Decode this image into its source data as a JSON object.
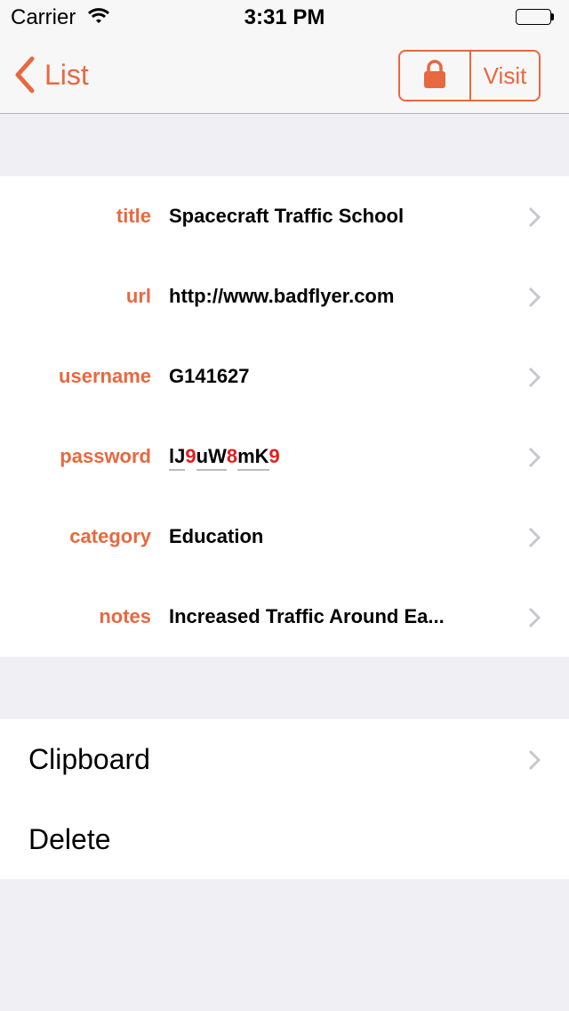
{
  "status_bar": {
    "carrier": "Carrier",
    "time": "3:31 PM"
  },
  "nav": {
    "back_label": "List",
    "visit_label": "Visit"
  },
  "fields": [
    {
      "label": "title",
      "value": "Spacecraft Traffic School"
    },
    {
      "label": "url",
      "value": "http://www.badflyer.com"
    },
    {
      "label": "username",
      "value": "G141627"
    },
    {
      "label": "password",
      "value": "lJ9uW8mK9"
    },
    {
      "label": "category",
      "value": "Education"
    },
    {
      "label": "notes",
      "value": "Increased Traffic Around Ea..."
    }
  ],
  "actions": [
    {
      "label": "Clipboard"
    },
    {
      "label": "Delete"
    }
  ],
  "colors": {
    "accent": "#e8683f",
    "digit": "#e02020",
    "background": "#efeff4"
  },
  "icons": [
    "wifi-icon",
    "battery-icon",
    "back-chevron-icon",
    "lock-icon",
    "chevron-right-icon"
  ]
}
